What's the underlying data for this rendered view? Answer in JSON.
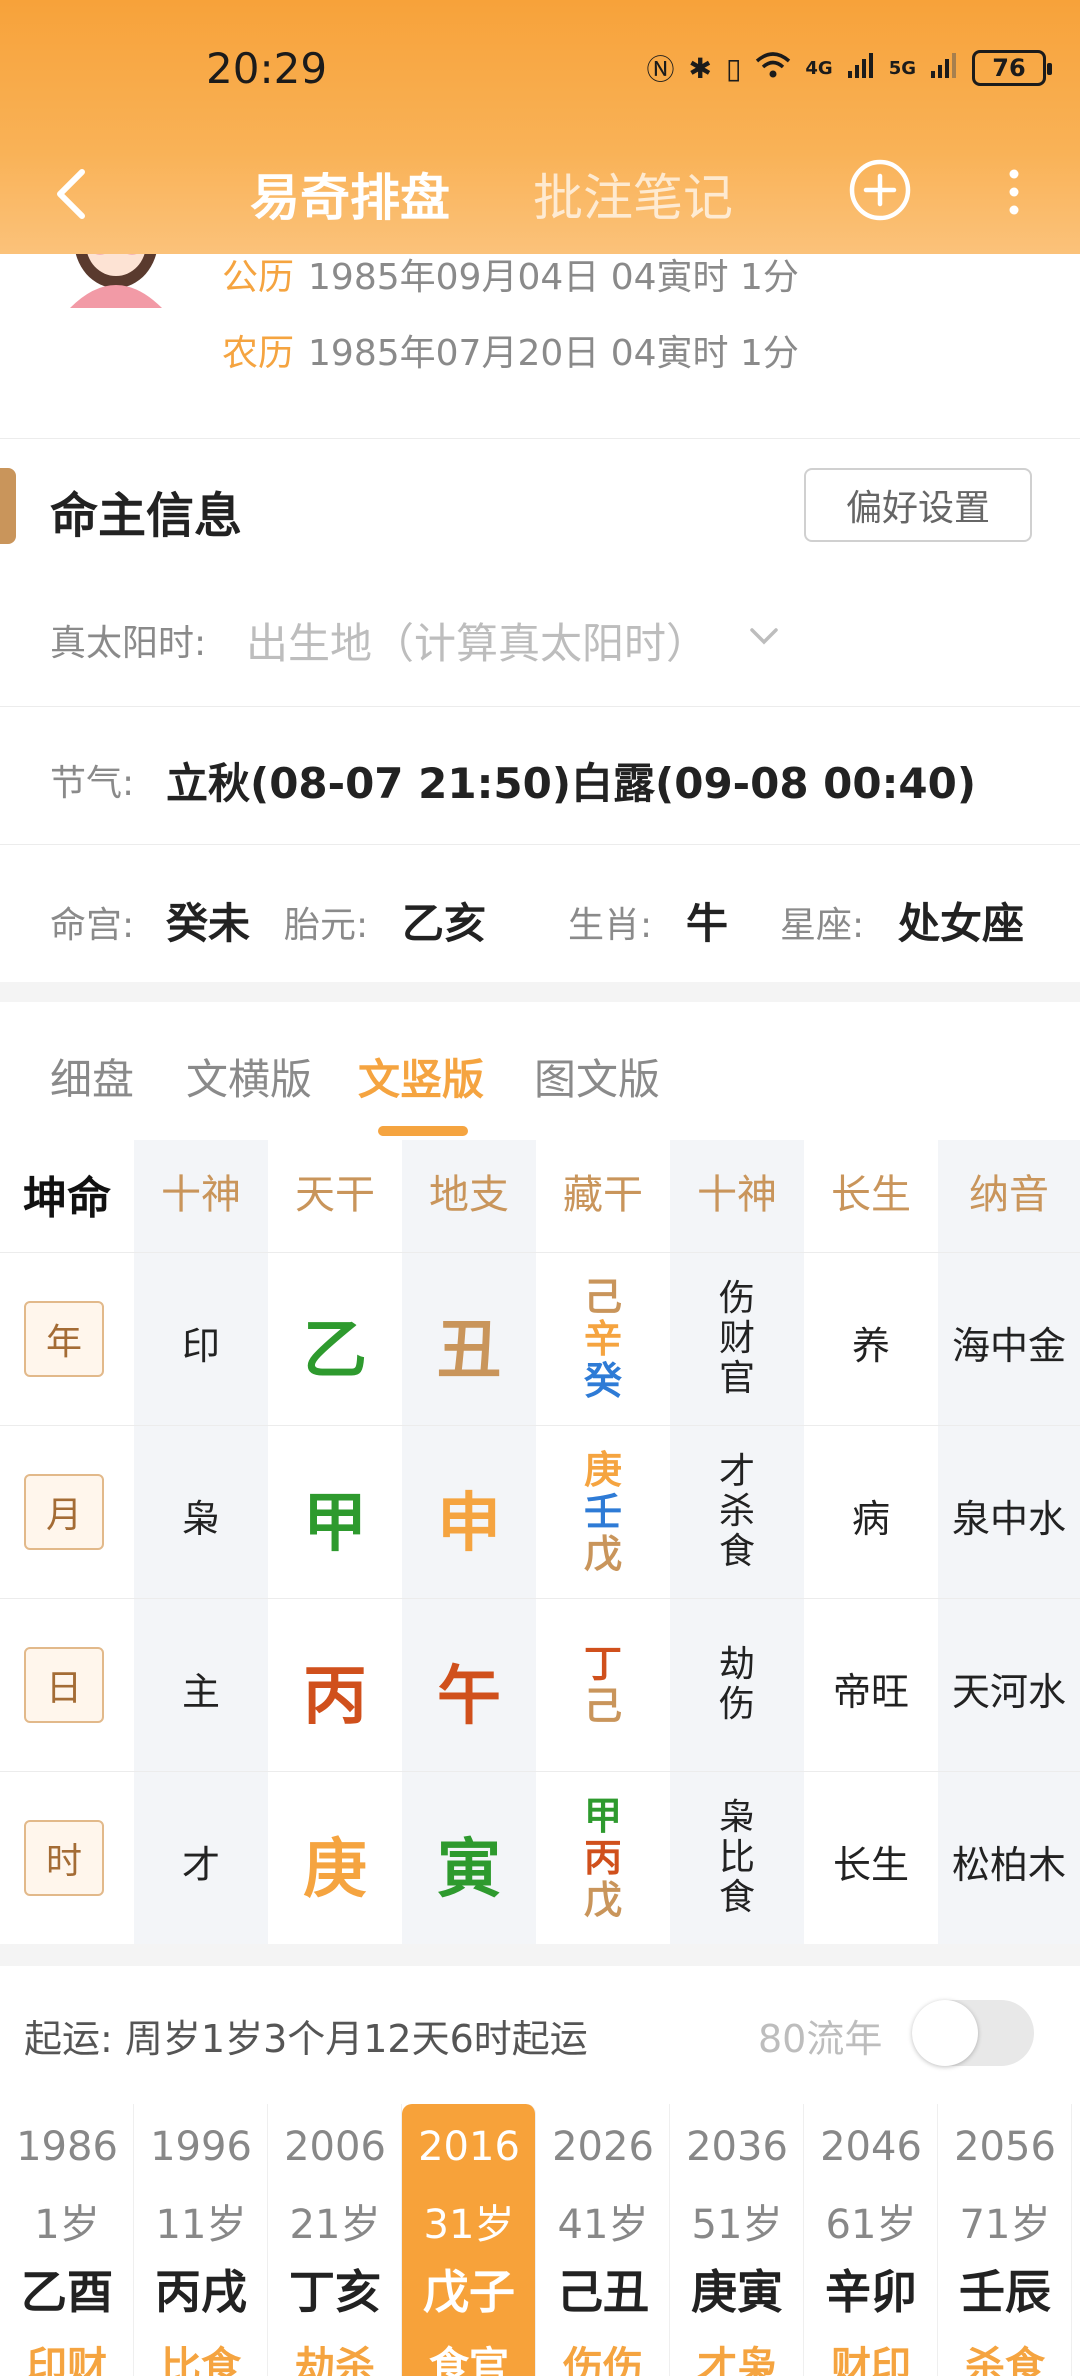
{
  "status": {
    "time": "20:29",
    "battery": "76",
    "net1": "4G",
    "net2": "5G"
  },
  "nav": {
    "title": "易奇排盘",
    "notes_tab": "批注笔记"
  },
  "birth": {
    "solar_label": "公历",
    "solar": "1985年09月04日 04寅时 1分",
    "lunar_label": "农历",
    "lunar": "1985年07月20日 04寅时 1分"
  },
  "section": {
    "title": "命主信息",
    "pref_button": "偏好设置"
  },
  "info": {
    "true_solar_label": "真太阳时:",
    "true_solar_placeholder": "出生地（计算真太阳时）",
    "jieqi_label": "节气:",
    "jieqi_value": "立秋(08-07 21:50)白露(09-08 00:40)",
    "minggong_label": "命宫:",
    "minggong_value": "癸未",
    "taiyuan_label": "胎元:",
    "taiyuan_value": "乙亥",
    "shengxiao_label": "生肖:",
    "shengxiao_value": "牛",
    "xingzuo_label": "星座:",
    "xingzuo_value": "处女座"
  },
  "view_tabs": [
    "细盘",
    "文横版",
    "文竖版",
    "图文版"
  ],
  "grid": {
    "corner": "坤命",
    "headers": [
      "十神",
      "天干",
      "地支",
      "藏干",
      "十神",
      "长生",
      "纳音"
    ],
    "rows": [
      {
        "pillar": "年",
        "shishen": "印",
        "gan": "乙",
        "gan_color": "#2e9a2e",
        "zhi": "丑",
        "zhi_color": "#c9955b",
        "canggan": [
          {
            "c": "己",
            "color": "#c9955b"
          },
          {
            "c": "辛",
            "color": "#f5a440"
          },
          {
            "c": "癸",
            "color": "#2e7bd6"
          }
        ],
        "cang_shishen": [
          "伤",
          "财",
          "官"
        ],
        "changsheng": "养",
        "nayin": "海中金"
      },
      {
        "pillar": "月",
        "shishen": "枭",
        "gan": "甲",
        "gan_color": "#2e9a2e",
        "zhi": "申",
        "zhi_color": "#f5a440",
        "canggan": [
          {
            "c": "庚",
            "color": "#f5a440"
          },
          {
            "c": "壬",
            "color": "#2e7bd6"
          },
          {
            "c": "戊",
            "color": "#c9955b"
          }
        ],
        "cang_shishen": [
          "才",
          "杀",
          "食"
        ],
        "changsheng": "病",
        "nayin": "泉中水"
      },
      {
        "pillar": "日",
        "shishen": "主",
        "gan": "丙",
        "gan_color": "#d0501c",
        "zhi": "午",
        "zhi_color": "#d0501c",
        "canggan": [
          {
            "c": "丁",
            "color": "#d0501c"
          },
          {
            "c": "己",
            "color": "#c9955b"
          }
        ],
        "cang_shishen": [
          "劫",
          "伤"
        ],
        "changsheng": "帝旺",
        "nayin": "天河水"
      },
      {
        "pillar": "时",
        "shishen": "才",
        "gan": "庚",
        "gan_color": "#f5a440",
        "zhi": "寅",
        "zhi_color": "#2e9a2e",
        "canggan": [
          {
            "c": "甲",
            "color": "#2e9a2e"
          },
          {
            "c": "丙",
            "color": "#d0501c"
          },
          {
            "c": "戊",
            "color": "#c9955b"
          }
        ],
        "cang_shishen": [
          "枭",
          "比",
          "食"
        ],
        "changsheng": "长生",
        "nayin": "松柏木"
      }
    ]
  },
  "qiyun": {
    "label": "起运:",
    "text": "周岁1岁3个月12天6时起运",
    "liunian": "80流年"
  },
  "dayun": [
    {
      "year": "1986",
      "age": "1岁",
      "gz": "乙酉",
      "ss": "印财"
    },
    {
      "year": "1996",
      "age": "11岁",
      "gz": "丙戌",
      "ss": "比食"
    },
    {
      "year": "2006",
      "age": "21岁",
      "gz": "丁亥",
      "ss": "劫杀"
    },
    {
      "year": "2016",
      "age": "31岁",
      "gz": "戊子",
      "ss": "食官",
      "active": true
    },
    {
      "year": "2026",
      "age": "41岁",
      "gz": "己丑",
      "ss": "伤伤"
    },
    {
      "year": "2036",
      "age": "51岁",
      "gz": "庚寅",
      "ss": "才枭"
    },
    {
      "year": "2046",
      "age": "61岁",
      "gz": "辛卯",
      "ss": "财印"
    },
    {
      "year": "2056",
      "age": "71岁",
      "gz": "壬辰",
      "ss": "杀食"
    }
  ]
}
